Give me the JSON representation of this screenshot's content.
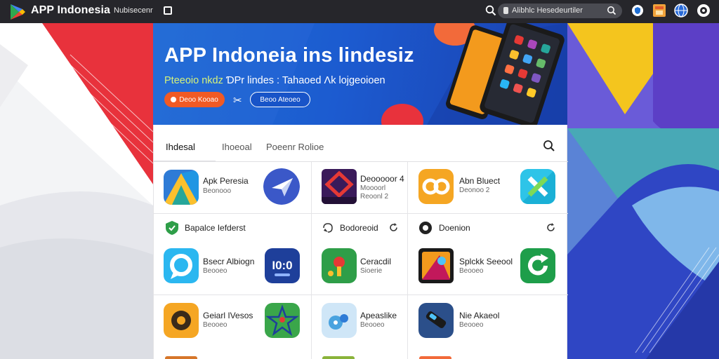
{
  "header": {
    "brand": "APP Indonesia",
    "nav_text": "Nubisecenr",
    "search_text": "Alibhlc Hesedeurtiler"
  },
  "hero": {
    "title": "APP Indoneia ins lindesiz",
    "subtitle_a": "Pteeoio nkdz",
    "subtitle_b": " ƊPr lindes : Tahaoed Ʌk lojgeoioen",
    "button_primary": "Deoo Kooao",
    "button_secondary": "Beoo Ateoeo"
  },
  "tabs": [
    "Ihdesal",
    "Ihoeoal",
    "Poeenr Rolioe"
  ],
  "rows": [
    {
      "left": {
        "name": "Apk Peresia",
        "sub": [
          "Beonooo"
        ]
      },
      "middle": {
        "name": "Deooooor 4",
        "sub": [
          "Moooorl",
          "Reoonl 2"
        ]
      },
      "right": {
        "name": "Abn Bluect",
        "sub": [
          "Deonoo 2"
        ]
      }
    }
  ],
  "sections": [
    {
      "title": "Bapalce Iefderst"
    },
    {
      "title": "Bodoreoid"
    },
    {
      "title": "Doenion"
    }
  ],
  "apps_row2": [
    {
      "name": "Bsecr Albiogn",
      "sub": [
        "Beooeo",
        "Beooeo"
      ]
    },
    {
      "name": "Ceracdil",
      "sub": [
        "Beooeo",
        "Sioerie"
      ]
    },
    {
      "name": "Splckk Seeool",
      "sub": [
        "Beooeo",
        "Beooeo"
      ]
    }
  ],
  "apps_row3": [
    {
      "name": "Geiarl IVesos",
      "sub": [
        "Beooeo"
      ]
    },
    {
      "name": "Apeaslike",
      "sub": [
        "Beooeo"
      ]
    },
    {
      "name": "Nie Akaeol",
      "sub": [
        "Beooeo"
      ]
    }
  ],
  "colors": {
    "topbar": "#26262b",
    "hero_blue": "#1c5bd0",
    "accent_orange": "#f15a24",
    "accent_lime": "#d6f27a"
  },
  "icons": [
    "play-logo-icon",
    "search-icon",
    "lock-icon",
    "shield-icon",
    "shop-icon",
    "globe-icon",
    "settings-icon",
    "refresh-icon",
    "share-icon"
  ]
}
